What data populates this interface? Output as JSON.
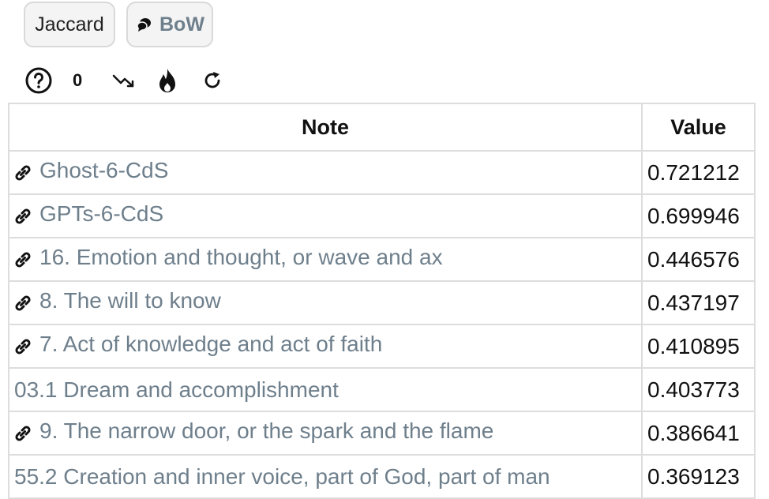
{
  "tabs": [
    {
      "label": "Jaccard",
      "icon": null
    },
    {
      "label": "BoW",
      "icon": "chat-bubbles-icon"
    }
  ],
  "toolbar": {
    "help_icon": "help-circle-icon",
    "count": "0",
    "trend_icon": "trending-down-icon",
    "flame_icon": "flame-icon",
    "refresh_icon": "refresh-icon"
  },
  "table": {
    "headers": {
      "note": "Note",
      "value": "Value"
    },
    "rows": [
      {
        "note": "Ghost-6-CdS",
        "value": "0.721212",
        "linked": true
      },
      {
        "note": "GPTs-6-CdS",
        "value": "0.699946",
        "linked": true
      },
      {
        "note": "16. Emotion and thought, or wave and ax",
        "value": "0.446576",
        "linked": true
      },
      {
        "note": "8. The will to know",
        "value": "0.437197",
        "linked": true
      },
      {
        "note": "7. Act of knowledge and act of faith",
        "value": "0.410895",
        "linked": true
      },
      {
        "note": "03.1 Dream and accomplishment",
        "value": "0.403773",
        "linked": false
      },
      {
        "note": "9. The narrow door, or the spark and the flame",
        "value": "0.386641",
        "linked": true
      },
      {
        "note": "55.2 Creation and inner voice, part of God, part of man",
        "value": "0.369123",
        "linked": false
      }
    ]
  },
  "colors": {
    "link": "#6e7f8c",
    "border": "#dddddd",
    "tab_bg": "#f4f4f4"
  }
}
